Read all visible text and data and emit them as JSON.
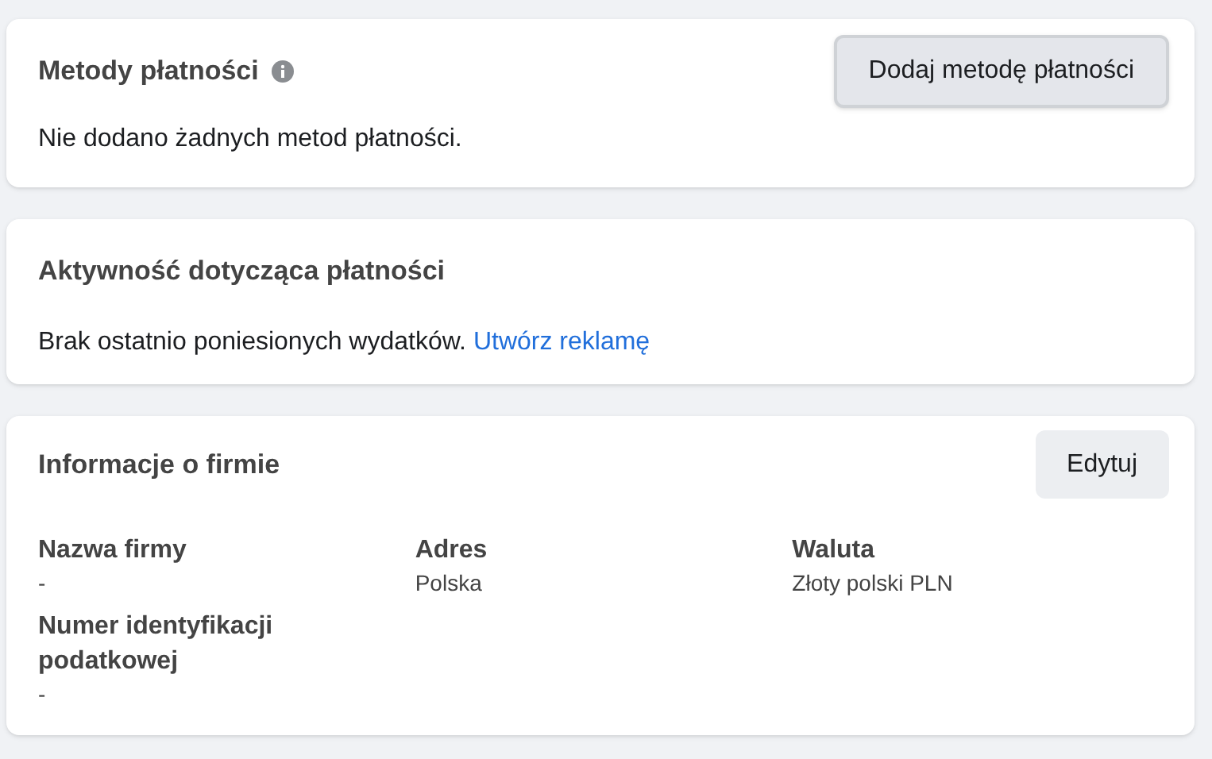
{
  "payment_methods": {
    "title": "Metody płatności",
    "add_button": "Dodaj metodę płatności",
    "message": "Nie dodano żadnych metod płatności."
  },
  "payment_activity": {
    "title": "Aktywność dotycząca płatności",
    "message": "Brak ostatnio poniesionych wydatków.",
    "link": "Utwórz reklamę"
  },
  "business_info": {
    "title": "Informacje o firmie",
    "edit_button": "Edytuj",
    "columns": [
      {
        "fields": [
          {
            "label": "Nazwa firmy",
            "value": "-"
          },
          {
            "label": "Numer identyfikacji podatkowej",
            "value": "-"
          }
        ]
      },
      {
        "fields": [
          {
            "label": "Adres",
            "value": "Polska"
          }
        ]
      },
      {
        "fields": [
          {
            "label": "Waluta",
            "value": "Złoty polski PLN"
          }
        ]
      }
    ]
  }
}
